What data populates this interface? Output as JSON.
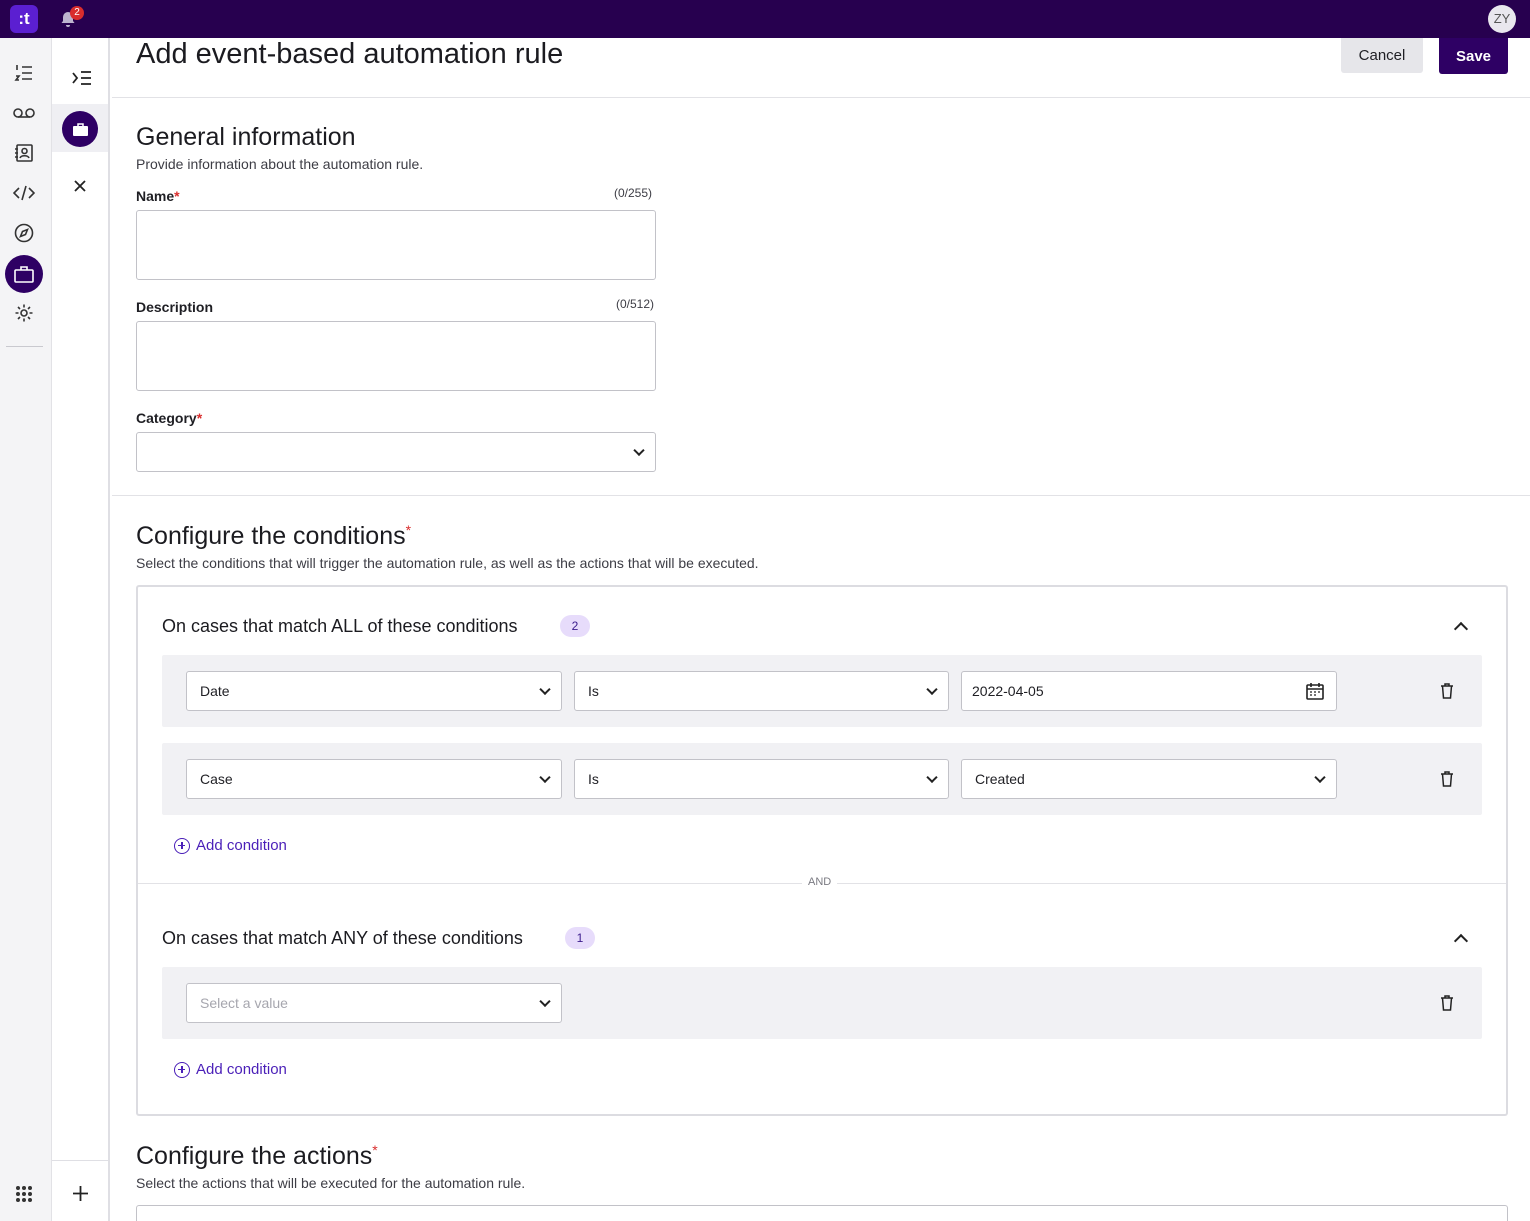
{
  "topbar": {
    "logo_text": ":t",
    "notification_count": "2",
    "avatar_initials": "ZY"
  },
  "rail": {
    "items": [
      {
        "icon": "list-numbered-icon"
      },
      {
        "icon": "voicemail-icon"
      },
      {
        "icon": "contacts-book-icon"
      },
      {
        "icon": "code-icon"
      },
      {
        "icon": "compass-icon"
      },
      {
        "icon": "briefcase-icon",
        "active": true
      },
      {
        "icon": "gear-icon"
      }
    ],
    "bottom_icon": "apps-grid-icon"
  },
  "subnav": {
    "collapse_icon": "menu-collapse-icon",
    "selected_icon": "briefcase-icon",
    "close_icon": "close-icon",
    "add_icon": "plus-icon"
  },
  "header": {
    "title": "Add event-based automation rule",
    "cancel_label": "Cancel",
    "save_label": "Save"
  },
  "general": {
    "title": "General information",
    "subtitle": "Provide information about the automation rule.",
    "name_label": "Name",
    "name_counter": "(0/255)",
    "name_value": "",
    "description_label": "Description",
    "description_counter": "(0/512)",
    "description_value": "",
    "category_label": "Category",
    "category_value": ""
  },
  "conditions": {
    "title": "Configure the conditions",
    "subtitle": "Select the conditions that will trigger the automation rule, as well as the actions that will be executed.",
    "all_group": {
      "title": "On cases that match ALL of these conditions",
      "count": "2",
      "rows": [
        {
          "field": "Date",
          "operator": "Is",
          "value": "2022-04-05"
        },
        {
          "field": "Case",
          "operator": "Is",
          "value": "Created"
        }
      ],
      "add_label": "Add condition"
    },
    "and_label": "AND",
    "any_group": {
      "title": "On cases that match ANY of these conditions",
      "count": "1",
      "rows": [
        {
          "field_placeholder": "Select a value"
        }
      ],
      "add_label": "Add condition"
    }
  },
  "actions": {
    "title": "Configure the actions",
    "subtitle": "Select the actions that will be executed for the automation rule."
  },
  "colors": {
    "topbar": "#27004f",
    "primary": "#2e0064",
    "link": "#4a1fb8",
    "required": "#d92d2d",
    "badge_bg": "#e7dcfb"
  }
}
